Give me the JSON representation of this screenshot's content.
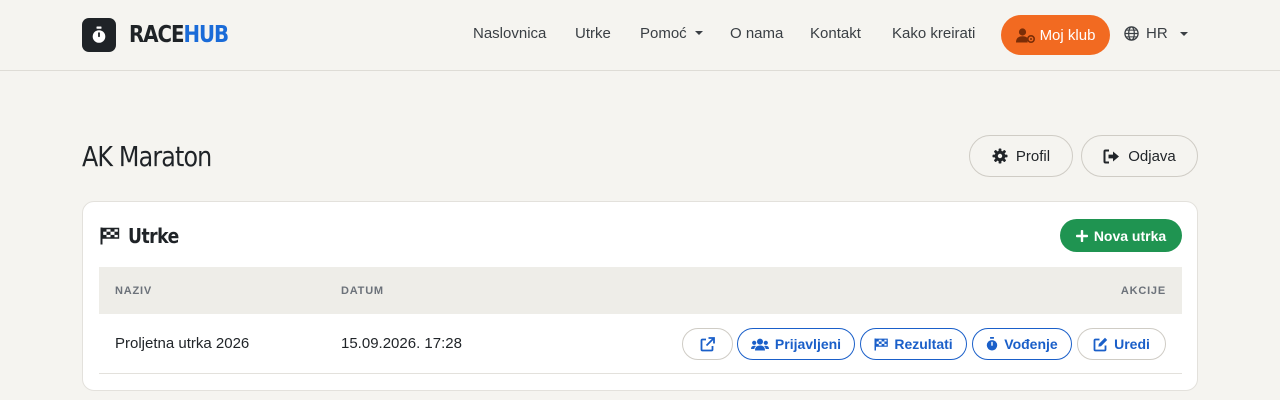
{
  "navbar": {
    "brand_race": "RACE",
    "brand_hub": "HUB",
    "links": {
      "home": "Naslovnica",
      "races": "Utrke",
      "help": "Pomoć",
      "about": "O nama",
      "contact": "Kontakt",
      "how_to": "Kako kreirati"
    },
    "club_button": "Moj klub",
    "language": "HR"
  },
  "header": {
    "title": "AK Maraton",
    "profile_button": "Profil",
    "logout_button": "Odjava"
  },
  "races_card": {
    "title": "Utrke",
    "new_button": "Nova utrka",
    "columns": {
      "name": "NAZIV",
      "date": "DATUM",
      "actions": "AKCIJE"
    },
    "rows": [
      {
        "name": "Proljetna utrka 2026",
        "date": "15.09.2026. 17:28",
        "actions": {
          "registered": "Prijavljeni",
          "results": "Rezultati",
          "timing": "Vođenje",
          "edit": "Uredi"
        }
      }
    ]
  },
  "colors": {
    "accent_orange": "#f26a21",
    "brand_blue": "#1a6bd8",
    "success_green": "#1f9451",
    "action_blue": "#1a5fc9"
  }
}
